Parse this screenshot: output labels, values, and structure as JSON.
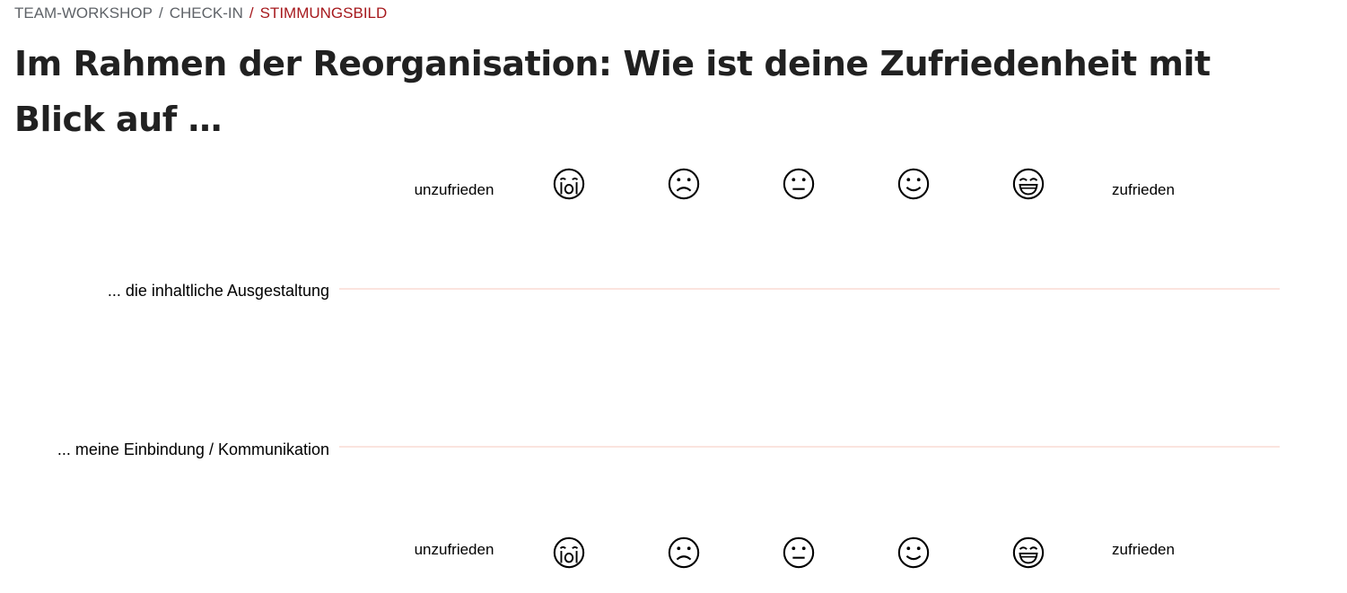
{
  "breadcrumb": {
    "items": [
      "TEAM-WORKSHOP",
      "CHECK-IN",
      "STIMMUNGSBILD"
    ],
    "separator": "/"
  },
  "title": "Im Rahmen der Reorganisation: Wie ist deine Zufriedenheit mit Blick auf …",
  "scale": {
    "left_label": "unzufrieden",
    "right_label": "zufrieden",
    "emojis": [
      "crying-face-icon",
      "frowning-face-icon",
      "neutral-face-icon",
      "smiling-face-icon",
      "grinning-face-icon"
    ]
  },
  "rows": [
    {
      "label": "... die inhaltliche Ausgestaltung"
    },
    {
      "label": "... meine Einbindung / Kommunikation"
    }
  ],
  "colors": {
    "active_breadcrumb": "#a6191d",
    "track": "#fbe4de"
  }
}
